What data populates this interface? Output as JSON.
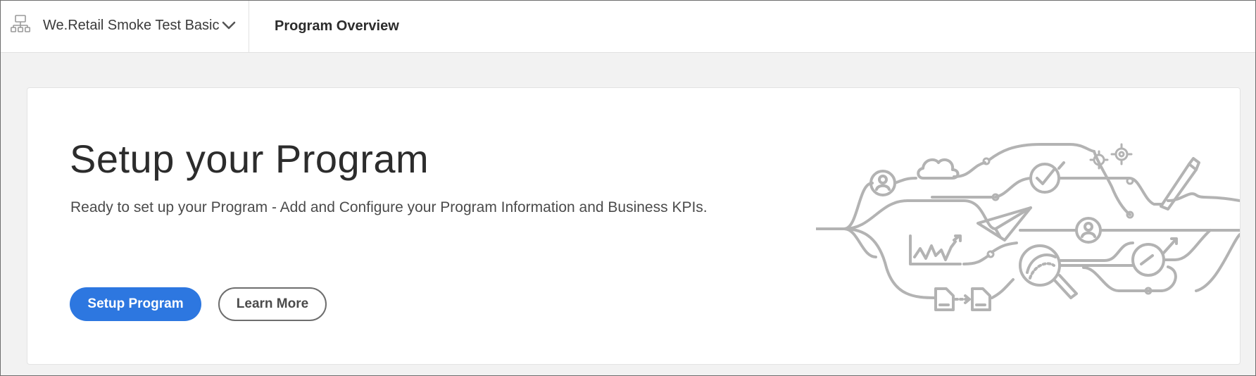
{
  "header": {
    "program_name": "We.Retail Smoke Test Basic",
    "page_title": "Program Overview",
    "icons": {
      "site": "site-structure-icon",
      "switcher": "chevron-down-icon"
    }
  },
  "setup_card": {
    "title": "Setup your Program",
    "description": "Ready to set up your Program - Add and Configure your Program Information and Business KPIs.",
    "primary_button": "Setup Program",
    "secondary_button": "Learn More",
    "illustration": "workflow-network-illustration"
  },
  "colors": {
    "accent": "#2d77e0",
    "illustration_stroke": "#b3b3b3",
    "background": "#f2f2f2"
  }
}
